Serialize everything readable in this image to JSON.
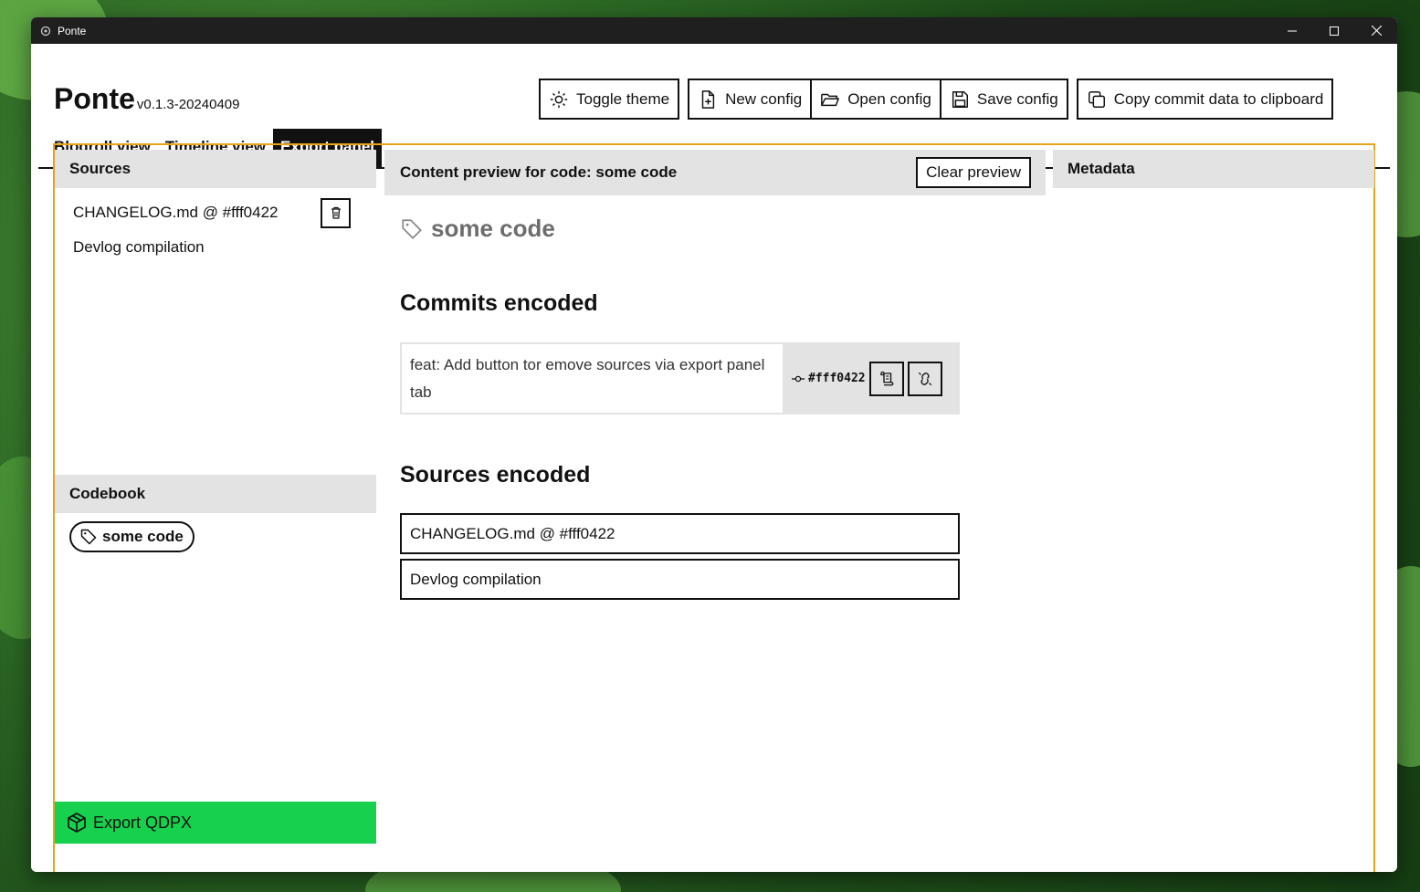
{
  "window": {
    "title": "Ponte"
  },
  "app": {
    "name": "Ponte",
    "version": "v0.1.3-20240409"
  },
  "toolbar": {
    "toggle_theme": "Toggle theme",
    "new_config": "New config",
    "open_config": "Open config",
    "save_config": "Save config",
    "copy_commit": "Copy commit data to clipboard"
  },
  "tabs": [
    {
      "label": "Blogroll view"
    },
    {
      "label": "Timeline view"
    },
    {
      "label": "Export panel"
    }
  ],
  "sources": {
    "heading": "Sources",
    "items": [
      {
        "label": "CHANGELOG.md @ #fff0422"
      },
      {
        "label": "Devlog compilation"
      }
    ]
  },
  "codebook": {
    "heading": "Codebook",
    "codes": [
      {
        "label": "some code"
      }
    ]
  },
  "export_button": "Export QDPX",
  "preview": {
    "heading": "Content preview for code: some code",
    "clear_label": "Clear preview",
    "code_name": "some code",
    "commits_heading": "Commits encoded",
    "commit": {
      "message": "feat: Add button tor emove sources via export panel tab",
      "hash": "#fff0422"
    },
    "sources_heading": "Sources encoded",
    "sources_encoded": [
      {
        "label": "CHANGELOG.md @ #fff0422"
      },
      {
        "label": "Devlog compilation"
      }
    ]
  },
  "metadata": {
    "heading": "Metadata"
  },
  "colors": {
    "accent_border": "#e8a317",
    "export_green": "#17d14e",
    "panel_gray": "#e3e3e3"
  }
}
